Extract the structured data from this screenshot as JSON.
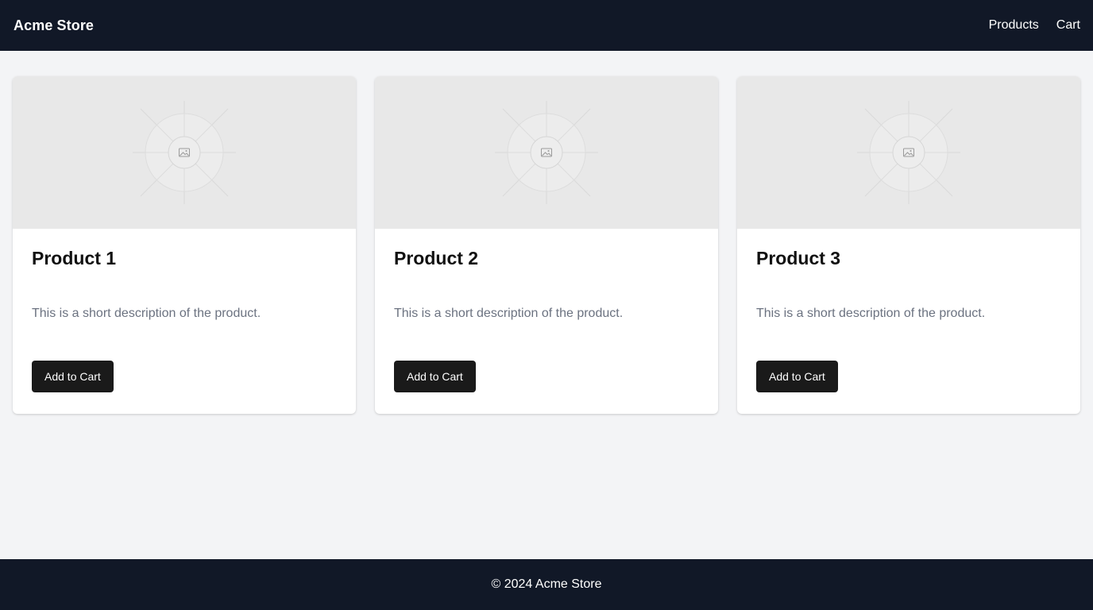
{
  "header": {
    "brand": "Acme Store",
    "nav": [
      {
        "label": "Products"
      },
      {
        "label": "Cart"
      }
    ]
  },
  "products": [
    {
      "title": "Product 1",
      "description": "This is a short description of the product.",
      "button_label": "Add to Cart"
    },
    {
      "title": "Product 2",
      "description": "This is a short description of the product.",
      "button_label": "Add to Cart"
    },
    {
      "title": "Product 3",
      "description": "This is a short description of the product.",
      "button_label": "Add to Cart"
    }
  ],
  "footer": {
    "text": "© 2024 Acme Store"
  },
  "icons": {
    "product_image": "image-placeholder-icon"
  },
  "colors": {
    "header_bg": "#111827",
    "page_bg": "#f3f4f6",
    "button_bg": "#1a1a1a"
  }
}
